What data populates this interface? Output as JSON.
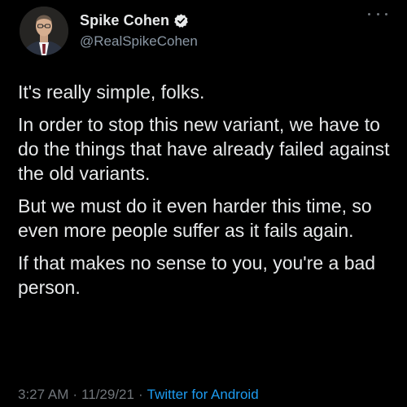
{
  "tweet": {
    "author": {
      "display_name": "Spike Cohen",
      "handle": "@RealSpikeCohen",
      "verified": true,
      "avatar_icon": "profile-photo"
    },
    "more_icon": "ellipsis-icon",
    "paragraphs": [
      "It's really simple, folks.",
      "In order to stop this new variant, we have to do the things that have already failed against the old variants.",
      "But we must do it even harder this time, so even more people suffer as it fails again.",
      "If that makes no sense to you, you're a bad person."
    ],
    "meta": {
      "time": "3:27 AM",
      "separator": "·",
      "date": "11/29/21",
      "source": "Twitter for Android"
    }
  },
  "colors": {
    "background": "#000000",
    "text": "#e7e9ea",
    "secondary": "#71767b",
    "link": "#1d9bf0",
    "verified": "#e7e9ea"
  }
}
